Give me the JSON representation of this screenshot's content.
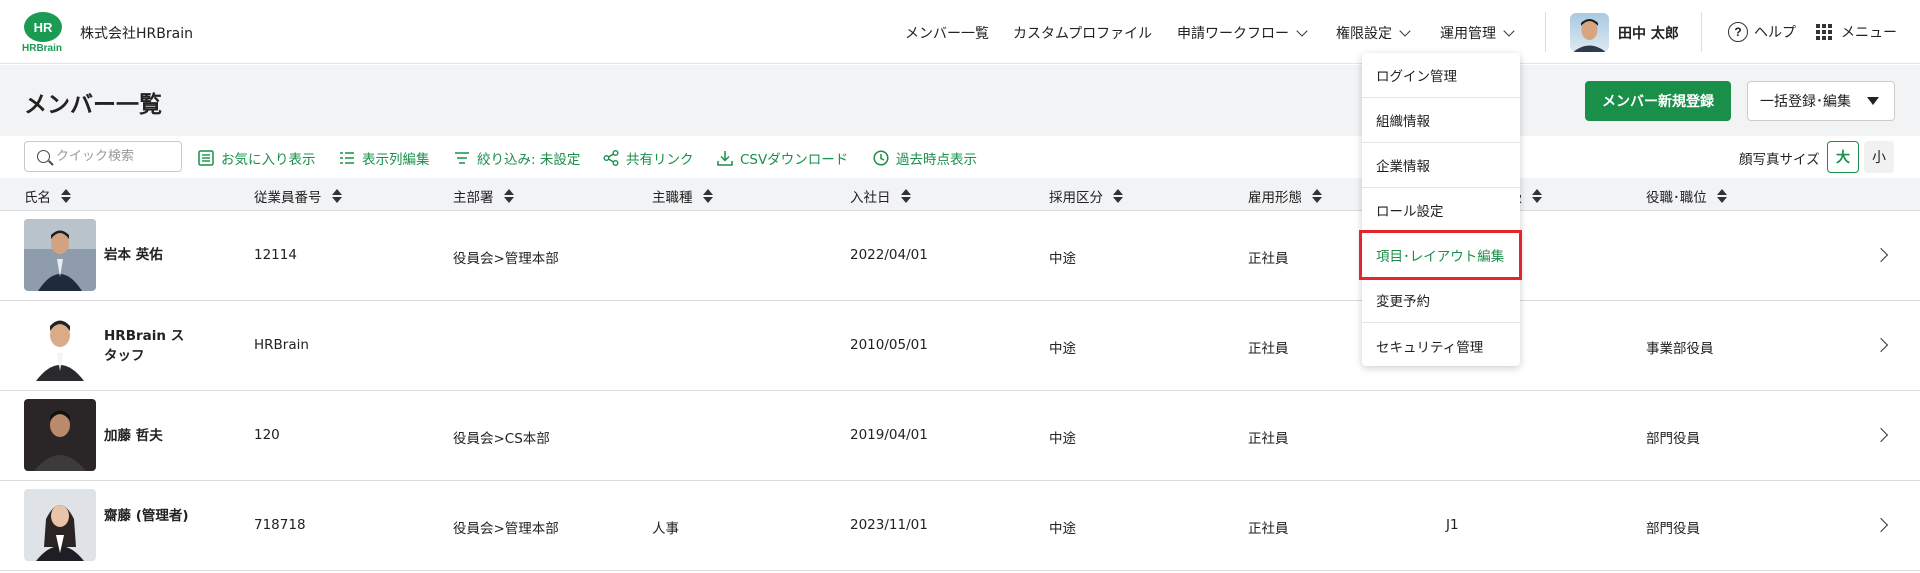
{
  "header": {
    "logo_text": "HR",
    "logo_sub": "HRBrain",
    "company": "株式会社HRBrain",
    "nav": [
      {
        "label": "メンバー一覧",
        "has_chevron": false
      },
      {
        "label": "カスタムプロファイル",
        "has_chevron": false
      },
      {
        "label": "申請ワークフロー",
        "has_chevron": true
      },
      {
        "label": "権限設定",
        "has_chevron": true
      },
      {
        "label": "運用管理",
        "has_chevron": true
      }
    ],
    "user_name": "田中 太郎",
    "help_label": "ヘルプ",
    "help_icon_glyph": "?",
    "menu_label": "メニュー"
  },
  "page": {
    "title": "メンバー一覧",
    "new_member_button": "メンバー新規登録",
    "bulk_button": "一括登録･編集"
  },
  "toolbar": {
    "search_placeholder": "クイック検索",
    "favorites": "お気に入り表示",
    "columns_edit": "表示列編集",
    "filter": "絞り込み: 未設定",
    "share_link": "共有リンク",
    "csv_download": "CSVダウンロード",
    "past_view": "過去時点表示",
    "photo_size_label": "顔写真サイズ",
    "size_large": "大",
    "size_small": "小"
  },
  "table": {
    "headers": [
      "氏名",
      "従業員番号",
      "主部署",
      "主職種",
      "入社日",
      "採用区分",
      "雇用形態",
      "等級",
      "役職･職位"
    ],
    "rows": [
      {
        "name": "岩本 英佑",
        "employee_no": "12114",
        "department": "役員会>管理本部",
        "job_type": "",
        "hire_date": "2022/04/01",
        "recruit_type": "中途",
        "employment": "正社員",
        "grade": "",
        "position": ""
      },
      {
        "name": "HRBrain スタッフ",
        "employee_no": "HRBrain",
        "department": "",
        "job_type": "",
        "hire_date": "2010/05/01",
        "recruit_type": "中途",
        "employment": "正社員",
        "grade": "",
        "position": "事業部役員"
      },
      {
        "name": "加藤 哲夫",
        "employee_no": "120",
        "department": "役員会>CS本部",
        "job_type": "",
        "hire_date": "2019/04/01",
        "recruit_type": "中途",
        "employment": "正社員",
        "grade": "",
        "position": "部門役員"
      },
      {
        "name": "齋藤 (管理者)",
        "employee_no": "718718",
        "department": "役員会>管理本部",
        "job_type": "人事",
        "hire_date": "2023/11/01",
        "recruit_type": "中途",
        "employment": "正社員",
        "grade": "J1",
        "position": "部門役員"
      }
    ]
  },
  "dropdown": {
    "items": [
      "ログイン管理",
      "組織情報",
      "企業情報",
      "ロール設定",
      "項目･レイアウト編集",
      "変更予約",
      "セキュリティ管理"
    ],
    "highlighted_index": 4
  },
  "colors": {
    "brand_green": "#1a8f4a",
    "highlight_red": "#e3262b"
  }
}
